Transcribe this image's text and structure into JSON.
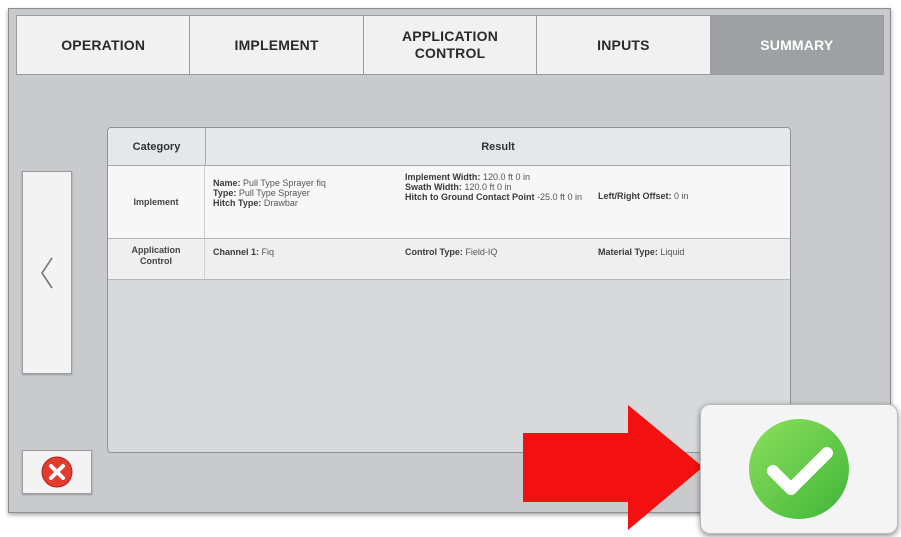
{
  "tabs": [
    {
      "label": "OPERATION",
      "active": false
    },
    {
      "label": "IMPLEMENT",
      "active": false
    },
    {
      "label": "APPLICATION\nCONTROL",
      "active": false
    },
    {
      "label": "INPUTS",
      "active": false
    },
    {
      "label": "SUMMARY",
      "active": true
    }
  ],
  "table": {
    "headers": {
      "category": "Category",
      "result": "Result"
    },
    "rows": [
      {
        "category": "Implement",
        "fields": [
          {
            "label": "Name:",
            "value": "Pull Type Sprayer fiq"
          },
          {
            "label": "Type:",
            "value": "Pull Type Sprayer"
          },
          {
            "label": "Hitch Type:",
            "value": "Drawbar"
          },
          {
            "label": "Implement Width:",
            "value": "120.0 ft 0 in"
          },
          {
            "label": "Swath Width:",
            "value": "120.0 ft 0 in"
          },
          {
            "label": "Hitch to Ground Contact Point",
            "value": "-25.0 ft 0 in"
          },
          {
            "label": "Left/Right Offset:",
            "value": "0 in"
          }
        ]
      },
      {
        "category": "Application\nControl",
        "fields": [
          {
            "label": "Channel 1:",
            "value": "Fiq"
          },
          {
            "label": "Control Type:",
            "value": "Field-IQ"
          },
          {
            "label": "Material Type:",
            "value": "Liquid"
          }
        ]
      }
    ]
  },
  "icons": {
    "back": "chevron-left-icon",
    "cancel": "red-x-circle-icon",
    "confirm": "green-check-circle-icon",
    "pointer": "red-arrow-right-icon"
  },
  "colors": {
    "screen_bg": "#c9cacc",
    "active_tab": "#9ea0a4",
    "cancel_red": "#e23b2f",
    "confirm_green": "#6cd04a",
    "arrow_red": "#f21010"
  }
}
